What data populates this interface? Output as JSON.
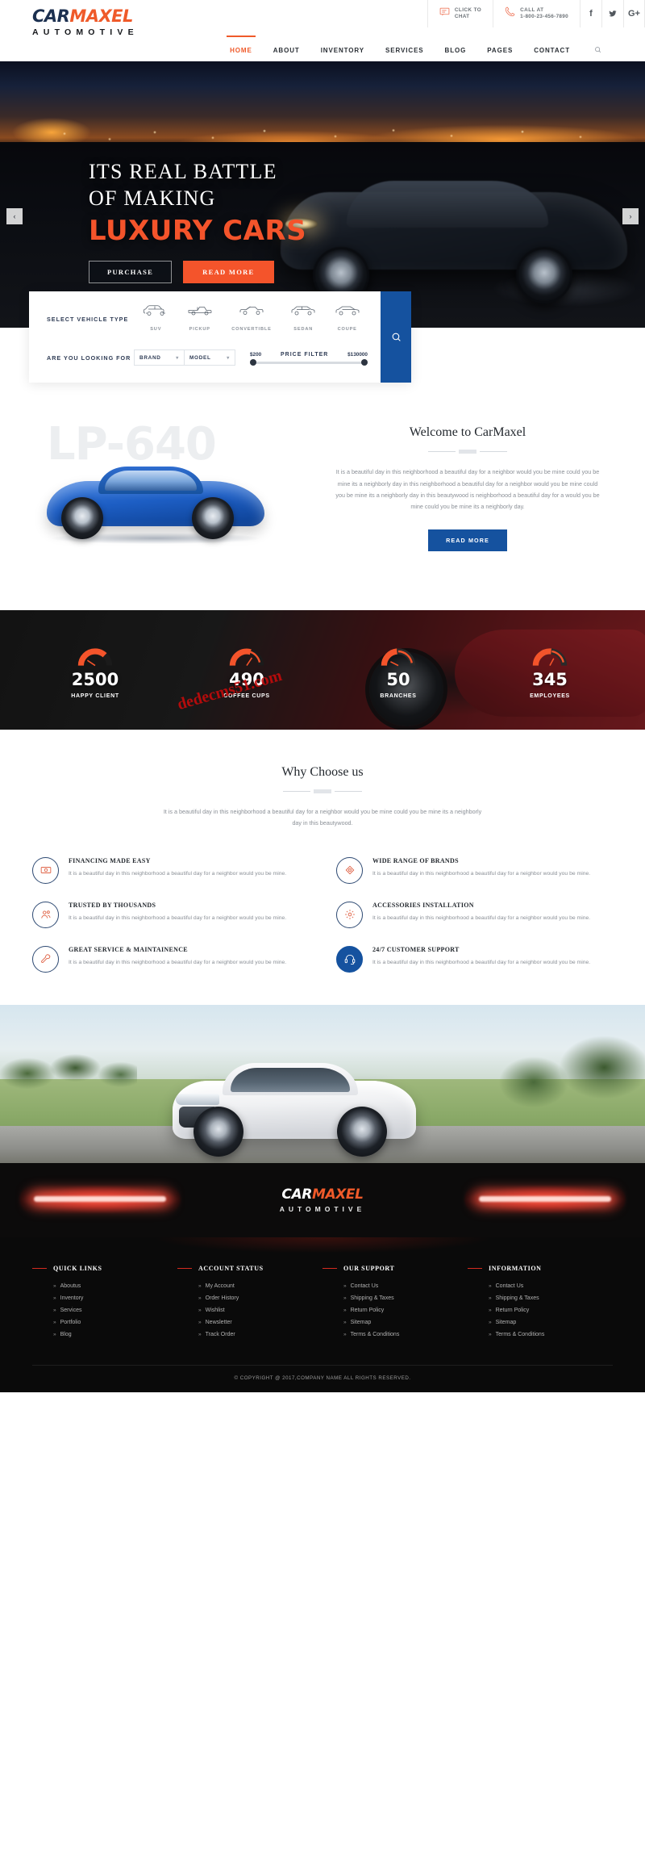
{
  "header": {
    "logo": {
      "part1": "CAR",
      "part2": "MAXEL",
      "tagline": "AUTOMOTIVE"
    },
    "contacts": [
      {
        "icon": "chat-icon",
        "line1": "CLICK TO",
        "line2": "CHAT"
      },
      {
        "icon": "phone-icon",
        "line1": "CALL AT",
        "line2": "1-800-23-456-7890"
      }
    ],
    "socials": [
      {
        "name": "facebook-icon",
        "glyph": "f"
      },
      {
        "name": "twitter-icon",
        "glyph": "ᵛ"
      },
      {
        "name": "google-plus-icon",
        "glyph": "G+"
      }
    ],
    "nav": [
      {
        "label": "HOME",
        "active": true
      },
      {
        "label": "ABOUT",
        "active": false
      },
      {
        "label": "INVENTORY",
        "active": false
      },
      {
        "label": "SERVICES",
        "active": false
      },
      {
        "label": "BLOG",
        "active": false
      },
      {
        "label": "PAGES",
        "active": false
      },
      {
        "label": "CONTACT",
        "active": false
      }
    ],
    "search_icon": "search-icon"
  },
  "hero": {
    "line1": "ITS REAL BATTLE",
    "line2": "OF MAKING",
    "line3": "LUXURY CARS",
    "btn_purchase": "PURCHASE",
    "btn_readmore": "READ MORE",
    "arrow_prev": "‹",
    "arrow_next": "›",
    "accent_color": "#f4542b"
  },
  "filter": {
    "label_vehicle_type": "SELECT VEHICLE TYPE",
    "label_looking_for": "ARE YOU LOOKING FOR",
    "vehicle_types": [
      {
        "label": "SUV",
        "icon": "suv-icon"
      },
      {
        "label": "PICKUP",
        "icon": "pickup-icon"
      },
      {
        "label": "CONVERTIBLE",
        "icon": "convertible-icon"
      },
      {
        "label": "SEDAN",
        "icon": "sedan-icon"
      },
      {
        "label": "COUPE",
        "icon": "coupe-icon"
      }
    ],
    "select_brand": "BRAND",
    "select_model": "MODEL",
    "price_title": "PRICE FILTER",
    "price_min": "$200",
    "price_max": "$130000",
    "search_icon": "search-icon",
    "button_color": "#15529f"
  },
  "welcome": {
    "ghost_text": "LP-640",
    "title": "Welcome to CarMaxel",
    "body": "It is a beautiful day in this neighborhood a beautiful day for a neighbor would you be mine could you be mine its a neighborly day in this neighborhood a beautiful day for a neighbor would you be mine could you be mine its a neighborly day in this beautywood is neighborhood a beautiful day for a would you be mine could you be mine its a neighborly day.",
    "button": "READ MORE"
  },
  "counters": [
    {
      "value": "2500",
      "label": "HAPPY CLIENT",
      "icon": "gauge-icon"
    },
    {
      "value": "490",
      "label": "COFFEE CUPS",
      "icon": "gauge-icon"
    },
    {
      "value": "50",
      "label": "BRANCHES",
      "icon": "gauge-icon"
    },
    {
      "value": "345",
      "label": "EMPLOYEES",
      "icon": "gauge-icon"
    }
  ],
  "watermark": "dedecms51.com",
  "why": {
    "title": "Why Choose us",
    "subtitle": "It is a beautiful day in this neighborhood a beautiful day for a neighbor would you be mine could you be mine its a neighborly day in this beautywood.",
    "features": [
      {
        "title": "FINANCING MADE EASY",
        "desc": "It is a beautiful day in this neighborhood a beautiful day for a neighbor would you be mine.",
        "icon": "money-icon",
        "filled": false
      },
      {
        "title": "WIDE RANGE OF BRANDS",
        "desc": "It is a beautiful day in this neighborhood a beautiful day for a neighbor would you be mine.",
        "icon": "tag-icon",
        "filled": false
      },
      {
        "title": "TRUSTED BY THOUSANDS",
        "desc": "It is a beautiful day in this neighborhood a beautiful day for a neighbor would you be mine.",
        "icon": "users-icon",
        "filled": false
      },
      {
        "title": "ACCESSORIES INSTALLATION",
        "desc": "It is a beautiful day in this neighborhood a beautiful day for a neighbor would you be mine.",
        "icon": "gear-icon",
        "filled": false
      },
      {
        "title": "GREAT SERVICE & MAINTAINENCE",
        "desc": "It is a beautiful day in this neighborhood a beautiful day for a neighbor would you be mine.",
        "icon": "wrench-icon",
        "filled": false
      },
      {
        "title": "24/7 CUSTOMER SUPPORT",
        "desc": "It is a beautiful day in this neighborhood a beautiful day for a neighbor would you be mine.",
        "icon": "headset-icon",
        "filled": true
      }
    ]
  },
  "footer": {
    "logo": {
      "part1": "CAR",
      "part2": "MAXEL",
      "tagline": "AUTOMOTIVE"
    },
    "columns": [
      {
        "title": "QUICK LINKS",
        "links": [
          "Aboutus",
          "Inventory",
          "Services",
          "Portfolio",
          "Blog"
        ]
      },
      {
        "title": "ACCOUNT STATUS",
        "links": [
          "My Account",
          "Order History",
          "Wishlist",
          "Newsletter",
          "Track Order"
        ]
      },
      {
        "title": "OUR SUPPORT",
        "links": [
          "Contact Us",
          "Shipping & Taxes",
          "Return Policy",
          "Sitemap",
          "Terms & Conditions"
        ]
      },
      {
        "title": "INFORMATION",
        "links": [
          "Contact Us",
          "Shipping & Taxes",
          "Return Policy",
          "Sitemap",
          "Terms & Conditions"
        ]
      }
    ],
    "copyright": "© COPYRIGHT @ 2017,COMPANY NAME ALL RIGHTS RESERVED."
  }
}
